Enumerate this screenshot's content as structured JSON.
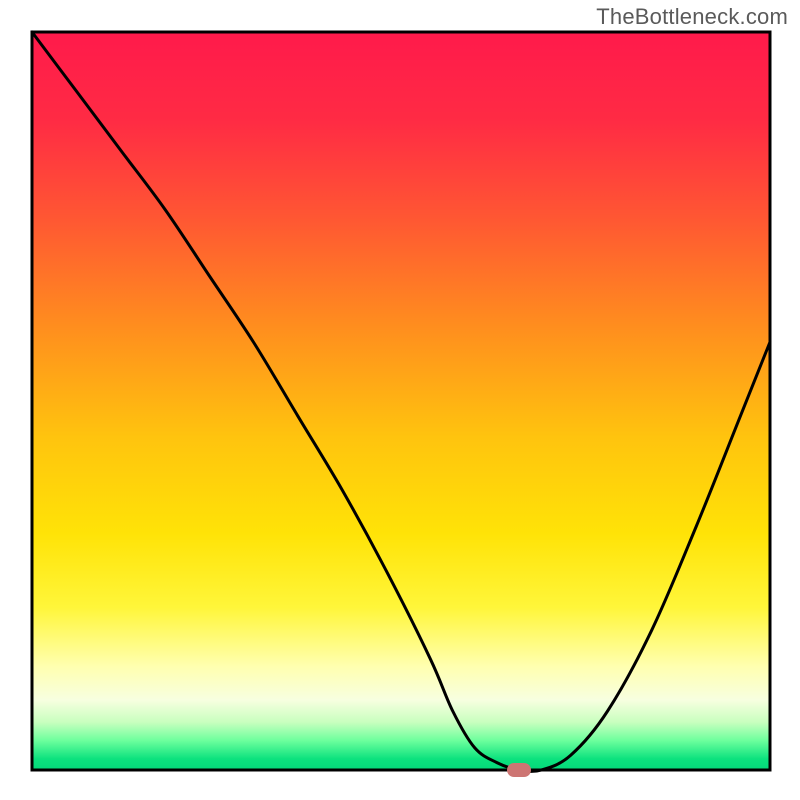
{
  "watermark": "TheBottleneck.com",
  "chart_data": {
    "type": "line",
    "title": "",
    "xlabel": "",
    "ylabel": "",
    "xlim": [
      0,
      100
    ],
    "ylim": [
      0,
      100
    ],
    "background_gradient_stops": [
      {
        "offset": 0.0,
        "color": "#ff1a4b"
      },
      {
        "offset": 0.12,
        "color": "#ff2b44"
      },
      {
        "offset": 0.25,
        "color": "#ff5633"
      },
      {
        "offset": 0.4,
        "color": "#ff8e1e"
      },
      {
        "offset": 0.55,
        "color": "#ffc40e"
      },
      {
        "offset": 0.68,
        "color": "#ffe307"
      },
      {
        "offset": 0.78,
        "color": "#fff63a"
      },
      {
        "offset": 0.86,
        "color": "#ffffb0"
      },
      {
        "offset": 0.905,
        "color": "#f7ffe0"
      },
      {
        "offset": 0.935,
        "color": "#c9ffbf"
      },
      {
        "offset": 0.96,
        "color": "#6dff9d"
      },
      {
        "offset": 0.985,
        "color": "#0ce27e"
      },
      {
        "offset": 1.0,
        "color": "#04d87a"
      }
    ],
    "series": [
      {
        "name": "bottleneck-curve",
        "x": [
          0,
          6,
          12,
          18,
          24,
          30,
          36,
          42,
          48,
          54,
          57,
          60,
          63,
          66,
          69,
          73,
          78,
          84,
          90,
          96,
          100
        ],
        "y": [
          100,
          92,
          84,
          76,
          67,
          58,
          48,
          38,
          27,
          15,
          8,
          3,
          1,
          0,
          0,
          2,
          8,
          19,
          33,
          48,
          58
        ]
      }
    ],
    "marker": {
      "x": 66,
      "y": 0,
      "color": "#cd7573"
    },
    "frame": {
      "stroke": "#000000",
      "width": 3
    }
  }
}
